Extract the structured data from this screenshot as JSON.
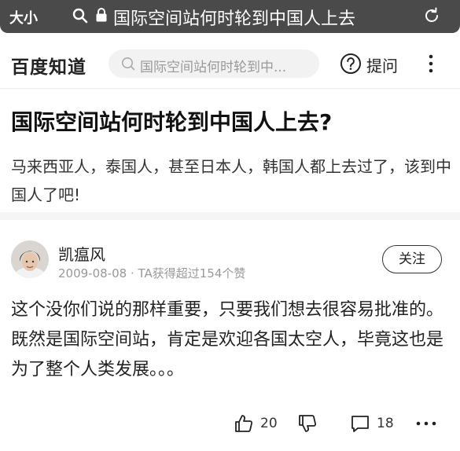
{
  "browser": {
    "text_size_label": "大小",
    "url_text": "国际空间站何时轮到中国人上去",
    "icons": [
      "search-icon",
      "lock-icon",
      "reload-icon"
    ]
  },
  "header": {
    "logo": "百度知道",
    "search_placeholder": "国际空间站何时轮到中...",
    "ask_label": "提问",
    "icons": [
      "search-icon",
      "question-mark-icon",
      "more-vertical-icon"
    ]
  },
  "question": {
    "title": "国际空间站何时轮到中国人上去?",
    "description": "马来西亚人，泰国人，甚至日本人，韩国人都上去过了，该到中国人了吧!"
  },
  "answer": {
    "author": "凯瘟风",
    "meta": "2009-08-08 · TA获得超过154个赞",
    "follow_label": "关注",
    "content": "这个没你们说的那样重要，只要我们想去很容易批准的。既然是国际空间站，肯定是欢迎各国太空人，毕竟这也是为了整个人类发展。。。",
    "likes": "20",
    "comments": "18",
    "icons": [
      "thumbs-up-icon",
      "thumbs-down-icon",
      "comment-icon",
      "more-horizontal-icon"
    ]
  },
  "colors": {
    "url_bar": "#4a4a4a",
    "search_bg": "#f2f2f2",
    "divider": "#f5f5f5",
    "meta_text": "#999999"
  }
}
